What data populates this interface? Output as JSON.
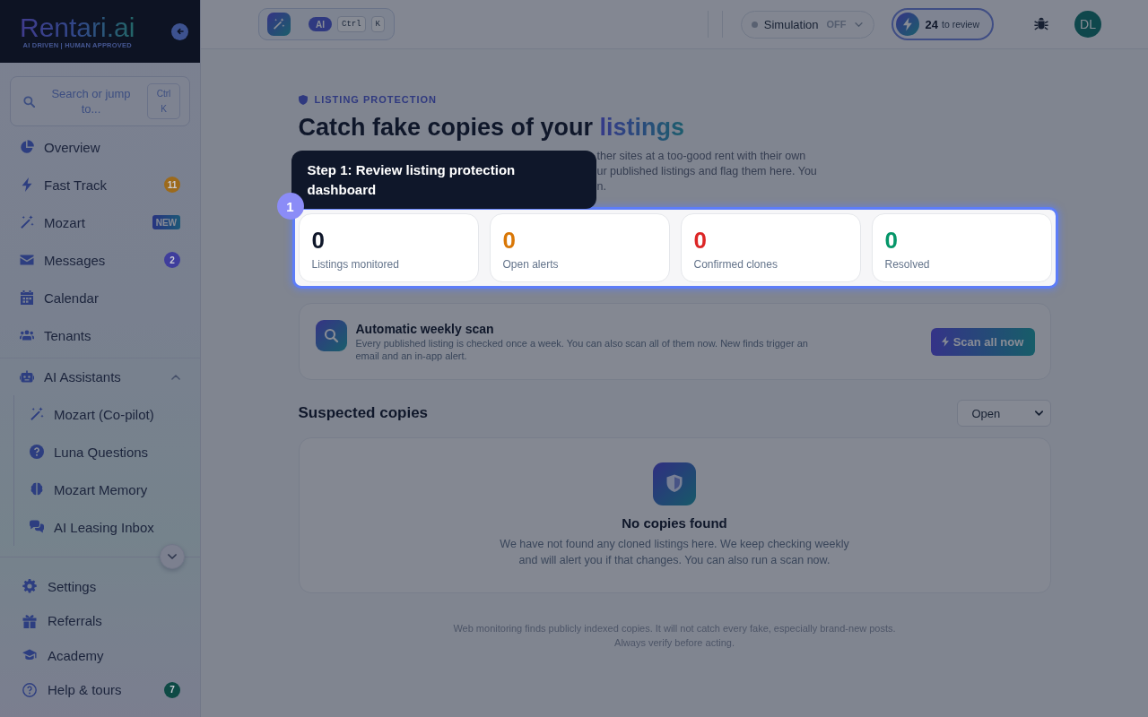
{
  "sidebar": {
    "logo": "Rentari.ai",
    "tagline": "AI DRIVEN | HUMAN APPROVED",
    "search": {
      "placeholder": "Search or jump to...",
      "shortcut": "Ctrl K"
    },
    "nav": [
      {
        "label": "Overview",
        "selected": false
      },
      {
        "label": "Fast Track",
        "selected": false,
        "badge": {
          "text": "11",
          "kind": "count",
          "color": "#9c6a1c"
        }
      },
      {
        "label": "Mozart",
        "selected": false,
        "badge": {
          "text": "NEW",
          "kind": "tag"
        }
      },
      {
        "label": "Messages",
        "selected": false,
        "badge": {
          "text": "2",
          "kind": "count",
          "color": "#3f3d9c"
        }
      },
      {
        "label": "Calendar",
        "selected": false
      },
      {
        "label": "Tenants",
        "selected": false
      },
      {
        "label": "AI Assistants",
        "selected": false,
        "expanded": true,
        "children": [
          {
            "label": "Mozart (Co-pilot)",
            "selected": false
          },
          {
            "label": "Luna Questions",
            "selected": false
          },
          {
            "label": "Mozart Memory",
            "selected": false
          },
          {
            "label": "AI Leasing Inbox",
            "selected": false
          }
        ]
      }
    ],
    "bottom_nav": [
      {
        "label": "Settings",
        "selected": false
      },
      {
        "label": "Referrals",
        "selected": false
      },
      {
        "label": "Academy",
        "selected": false
      },
      {
        "label": "Help & tours",
        "selected": false,
        "badge": {
          "text": "7",
          "kind": "count",
          "color": "#0e4a45"
        }
      }
    ]
  },
  "topbar": {
    "command": {
      "tag": "AI",
      "keys": [
        "Ctrl",
        "K"
      ]
    },
    "simulation": {
      "label": "Simulation",
      "state": "OFF",
      "on": false
    },
    "review": {
      "count": "24",
      "label": "to review"
    },
    "avatar": "DL"
  },
  "page": {
    "eyebrow": "LISTING PROTECTION",
    "title": "Catch fake copies of your",
    "title_highlight": "listings",
    "description_visible_lines": [
      "ther sites at a too-good rent with their own",
      "ur published listings and flag them here. You",
      "n."
    ]
  },
  "tour": {
    "step": "1",
    "text": "Step 1: Review listing protection dashboard"
  },
  "stats": [
    {
      "value": "0",
      "label": "Listings monitored",
      "color": "#0f172a"
    },
    {
      "value": "0",
      "label": "Open alerts",
      "color": "#d97706"
    },
    {
      "value": "0",
      "label": "Confirmed clones",
      "color": "#dc2626"
    },
    {
      "value": "0",
      "label": "Resolved",
      "color": "#059669"
    }
  ],
  "scan": {
    "title": "Automatic weekly scan",
    "text": "Every published listing is checked once a week. You can also scan all of them now. New finds trigger an email and an in-app alert.",
    "button": "Scan all now"
  },
  "suspected": {
    "title": "Suspected copies",
    "filter": "Open",
    "empty_title": "No copies found",
    "empty_text": "We have not found any cloned listings here. We keep checking weekly and will alert you if that changes. You can also run a scan now."
  },
  "footnote": "Web monitoring finds publicly indexed copies. It will not catch every fake, especially brand-new posts. Always verify before acting."
}
